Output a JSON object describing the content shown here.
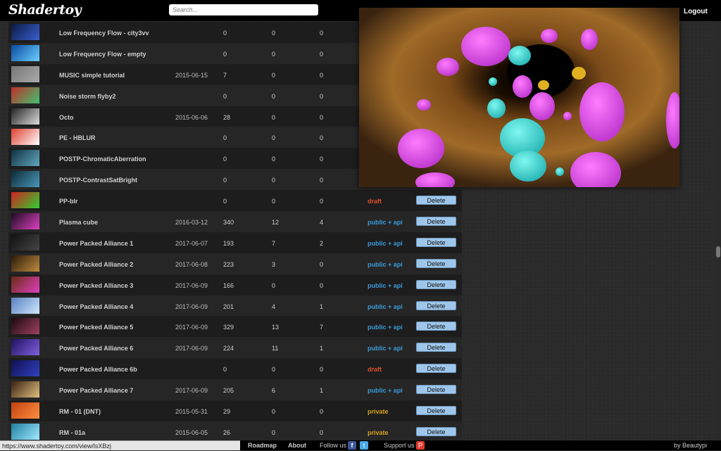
{
  "header": {
    "logo": "Shadertoy",
    "search_placeholder": "Search...",
    "logout": "Logout"
  },
  "rows": [
    {
      "name": "Low Frequency Flow - city3vv",
      "date": "",
      "views": "0",
      "likes": "0",
      "comments": "0",
      "status": "",
      "status_class": "",
      "delete": "",
      "thumb": [
        "#0a1a40",
        "#3a5fd0"
      ]
    },
    {
      "name": "Low Frequency Flow - empty",
      "date": "",
      "views": "0",
      "likes": "0",
      "comments": "0",
      "status": "",
      "status_class": "",
      "delete": "",
      "thumb": [
        "#0a4aa0",
        "#6ad0ff"
      ]
    },
    {
      "name": "MUSIC simple tutorial",
      "date": "2015-06-15",
      "views": "7",
      "likes": "0",
      "comments": "0",
      "status": "",
      "status_class": "",
      "delete": "",
      "thumb": [
        "#777",
        "#aaa"
      ]
    },
    {
      "name": "Noise storm flyby2",
      "date": "",
      "views": "0",
      "likes": "0",
      "comments": "0",
      "status": "",
      "status_class": "",
      "delete": "",
      "thumb": [
        "#c0302a",
        "#40c070"
      ]
    },
    {
      "name": "Octo",
      "date": "2015-06-06",
      "views": "28",
      "likes": "0",
      "comments": "0",
      "status": "",
      "status_class": "",
      "delete": "",
      "thumb": [
        "#222",
        "#ddd"
      ]
    },
    {
      "name": "PE - HBLUR",
      "date": "",
      "views": "0",
      "likes": "0",
      "comments": "0",
      "status": "",
      "status_class": "",
      "delete": "",
      "thumb": [
        "#e04030",
        "#ffffff"
      ]
    },
    {
      "name": "POSTP-ChromaticAberration",
      "date": "",
      "views": "0",
      "likes": "0",
      "comments": "0",
      "status": "",
      "status_class": "",
      "delete": "",
      "thumb": [
        "#123040",
        "#5fa8c0"
      ]
    },
    {
      "name": "POSTP-ContrastSatBright",
      "date": "",
      "views": "0",
      "likes": "0",
      "comments": "0",
      "status": "",
      "status_class": "",
      "delete": "",
      "thumb": [
        "#0c2a38",
        "#4a98b8"
      ]
    },
    {
      "name": "PP-blr",
      "date": "",
      "views": "0",
      "likes": "0",
      "comments": "0",
      "status": "draft",
      "status_class": "draft",
      "delete": "Delete",
      "thumb": [
        "#d02020",
        "#30d030"
      ]
    },
    {
      "name": "Plasma cube",
      "date": "2016-03-12",
      "views": "340",
      "likes": "12",
      "comments": "4",
      "status": "public + api",
      "status_class": "public",
      "delete": "Delete",
      "thumb": [
        "#1a0a20",
        "#e040c0"
      ]
    },
    {
      "name": "Power Packed Alliance 1",
      "date": "2017-06-07",
      "views": "193",
      "likes": "7",
      "comments": "2",
      "status": "public + api",
      "status_class": "public",
      "delete": "Delete",
      "thumb": [
        "#111",
        "#444"
      ]
    },
    {
      "name": "Power Packed Alliance 2",
      "date": "2017-06-08",
      "views": "223",
      "likes": "3",
      "comments": "0",
      "status": "public + api",
      "status_class": "public",
      "delete": "Delete",
      "thumb": [
        "#2a1a08",
        "#c08a40"
      ]
    },
    {
      "name": "Power Packed Alliance 3",
      "date": "2017-06-09",
      "views": "166",
      "likes": "0",
      "comments": "0",
      "status": "public + api",
      "status_class": "public",
      "delete": "Delete",
      "thumb": [
        "#6a2a10",
        "#e040c0"
      ]
    },
    {
      "name": "Power Packed Alliance 4",
      "date": "2017-06-09",
      "views": "201",
      "likes": "4",
      "comments": "1",
      "status": "public + api",
      "status_class": "public",
      "delete": "Delete",
      "thumb": [
        "#5a80c0",
        "#d0e8ff"
      ]
    },
    {
      "name": "Power Packed Alliance 5",
      "date": "2017-06-09",
      "views": "329",
      "likes": "13",
      "comments": "7",
      "status": "public + api",
      "status_class": "public",
      "delete": "Delete",
      "thumb": [
        "#1a0a10",
        "#a04060"
      ]
    },
    {
      "name": "Power Packed Alliance 6",
      "date": "2017-06-09",
      "views": "224",
      "likes": "11",
      "comments": "1",
      "status": "public + api",
      "status_class": "public",
      "delete": "Delete",
      "thumb": [
        "#201060",
        "#8060e0"
      ]
    },
    {
      "name": "Power Packed Alliance 6b",
      "date": "",
      "views": "0",
      "likes": "0",
      "comments": "0",
      "status": "draft",
      "status_class": "draft",
      "delete": "Delete",
      "thumb": [
        "#101050",
        "#3040c0"
      ]
    },
    {
      "name": "Power Packed Alliance 7",
      "date": "2017-06-09",
      "views": "205",
      "likes": "6",
      "comments": "1",
      "status": "public + api",
      "status_class": "public",
      "delete": "Delete",
      "thumb": [
        "#3a2010",
        "#e0c080"
      ]
    },
    {
      "name": "RM - 01 (DNT)",
      "date": "2015-05-31",
      "views": "29",
      "likes": "0",
      "comments": "0",
      "status": "private",
      "status_class": "private",
      "delete": "Delete",
      "thumb": [
        "#c04010",
        "#ff9040"
      ]
    },
    {
      "name": "RM - 01a",
      "date": "2015-06-05",
      "views": "26",
      "likes": "0",
      "comments": "0",
      "status": "private",
      "status_class": "private",
      "delete": "Delete",
      "thumb": [
        "#2080a0",
        "#a0e8ff"
      ]
    }
  ],
  "status_bar_url": "https://www.shadertoy.com/view/lsXBzj",
  "footer": {
    "roadmap": "Roadmap",
    "about": "About",
    "follow_us": "Follow us",
    "support_us": "Support us",
    "credit": "by Beautypi"
  }
}
